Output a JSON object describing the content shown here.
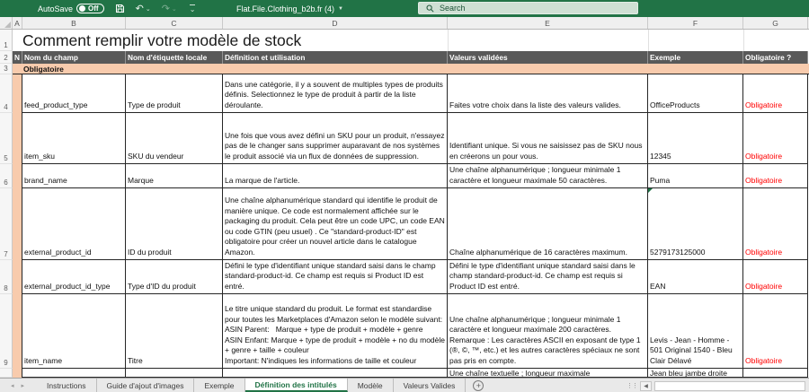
{
  "colors": {
    "titlebar_green": "#217346",
    "header_row_bg": "#595959",
    "section_bg": "#F8CBAD",
    "required_red": "#FF0000"
  },
  "titlebar": {
    "autosave_label": "AutoSave",
    "autosave_state": "Off",
    "filename": "Flat.File.Clothing_b2b.fr (4)",
    "search_placeholder": "Search"
  },
  "sheet": {
    "column_letters": [
      "A",
      "B",
      "C",
      "D",
      "E",
      "F",
      "G"
    ],
    "row_numbers": [
      "1",
      "2",
      "3",
      "4",
      "5",
      "6",
      "7",
      "8",
      "9"
    ],
    "title": "Comment remplir votre modèle de stock",
    "header": {
      "a": "N",
      "field": "Nom du champ",
      "local_label": "Nom d'étiquette locale",
      "definition": "Définition et utilisation",
      "valid_values": "Valeurs validées",
      "example": "Exemple",
      "required": "Obligatoire ?"
    },
    "section_label": "Obligatoire",
    "rows": [
      {
        "num": "4",
        "field": "feed_product_type",
        "label": "Type de produit",
        "definition": "Dans une catégorie, il y a souvent de multiples types de produits définis. Selectionnez le type de produit à partir de la liste déroulante.",
        "valid": "Faites votre choix dans la liste des valeurs valides.",
        "example": "OfficeProducts",
        "required": "Obligatoire"
      },
      {
        "num": "5",
        "field": "item_sku",
        "label": "SKU du vendeur",
        "definition": "Une fois que vous avez défini un SKU pour un produit, n'essayez pas de le changer sans supprimer auparavant de nos systèmes le produit associé via un flux de données de suppression.",
        "valid": "Identifiant unique. Si vous ne saisissez pas de SKU nous en créerons un pour vous.",
        "example": "12345",
        "required": "Obligatoire"
      },
      {
        "num": "6",
        "field": "brand_name",
        "label": "Marque",
        "definition": "La marque de l'article.",
        "valid": "Une chaîne alphanumérique ; longueur minimale 1 caractère et longueur maximale 50 caractères.",
        "example": "Puma",
        "required": "Obligatoire"
      },
      {
        "num": "7",
        "field": "external_product_id",
        "label": "ID du produit",
        "definition": "Une chaîne alphanumérique standard qui identifie le produit de manière unique. Ce code est normalement affichée sur le packaging du produit. Cela peut être un code UPC, un code EAN ou code GTIN (peu usuel) . Ce \"standard-product-ID\" est obligatoire pour créer un nouvel article dans le catalogue Amazon.",
        "valid": "Chaîne alphanumérique de 16 caractères maximum.",
        "example": "5279173125000",
        "required": "Obligatoire"
      },
      {
        "num": "8",
        "field": "external_product_id_type",
        "label": "Type d'ID du produit",
        "definition": "Défini le type d'identifiant unique standard saisi dans le champ standard-product-id. Ce champ est requis si Product ID est entré.",
        "valid": "Défini le type d'identifiant unique standard saisi dans le champ standard-product-id. Ce champ est requis si Product ID est entré.",
        "example": "EAN",
        "required": "Obligatoire"
      },
      {
        "num": "9",
        "field": "item_name",
        "label": "Titre",
        "definition": "Le titre unique standard du produit. Le format est standardise pour toutes les Marketplaces d'Amazon selon le modèle suivant:\nASIN Parent:   Marque + type de produit + modèle + genre\nASIN Enfant: Marque + type de produit + modèle + no du modèle + genre + taille + couleur\nImportant: N'indiques les informations de taille et couleur",
        "valid": "Une chaîne alphanumérique ; longueur minimale 1 caractère et longueur maximale 200 caractères.\nRemarque : Les caractères ASCII en exposant de type 1 (®, ©, ™, etc.) et les autres caractères spéciaux ne sont pas pris en compte.",
        "example": "Levis - Jean - Homme - 501 Original 1540 - Bleu Clair Délavé",
        "required": "Obligatoire"
      }
    ],
    "partial_row": {
      "valid": "Une chaîne textuelle ; longueur maximale",
      "example": "Jean bleu jambe droite"
    }
  },
  "tabbar": {
    "tabs": [
      "Instructions",
      "Guide d'ajout d'images",
      "Exemple",
      "Définition des intitulés",
      "Modèle",
      "Valeurs Valides"
    ],
    "active_tab": "Définition des intitulés",
    "add_sheet": "+"
  }
}
